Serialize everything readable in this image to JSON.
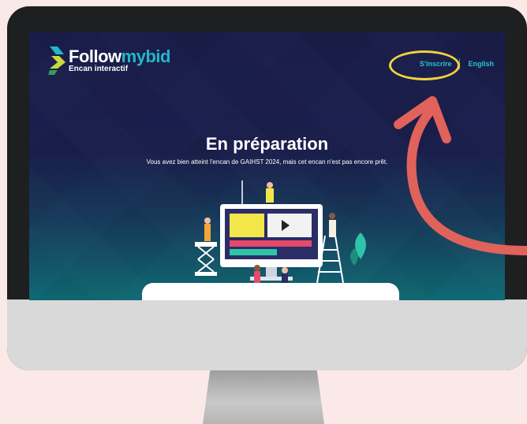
{
  "logo": {
    "name_part1": "Follow",
    "name_part2": "mybid",
    "tagline": "Encan interactif"
  },
  "nav": {
    "register": "S'inscrire",
    "language": "English"
  },
  "main": {
    "title": "En préparation",
    "subtitle": "Vous avez bien atteint l'encan de GAIHST 2024, mais cet encan n'est pas encore prêt."
  },
  "colors": {
    "accent": "#22b7c9",
    "highlight": "#f2d33a",
    "arrow": "#e0625b",
    "page_bg": "#fbe9e7"
  }
}
